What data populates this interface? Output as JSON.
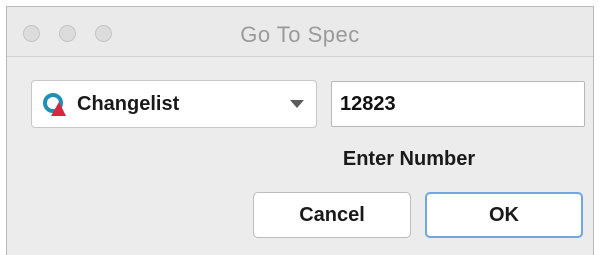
{
  "window": {
    "title": "Go To Spec"
  },
  "spec_type": {
    "selected": "Changelist",
    "icon": "changelist-icon"
  },
  "number_input": {
    "value": "12823"
  },
  "hint_text": "Enter Number",
  "buttons": {
    "cancel_label": "Cancel",
    "ok_label": "OK"
  },
  "colors": {
    "icon_teal": "#1f8fb8",
    "icon_red": "#d7263d",
    "default_button_border": "#6fa6e6"
  }
}
